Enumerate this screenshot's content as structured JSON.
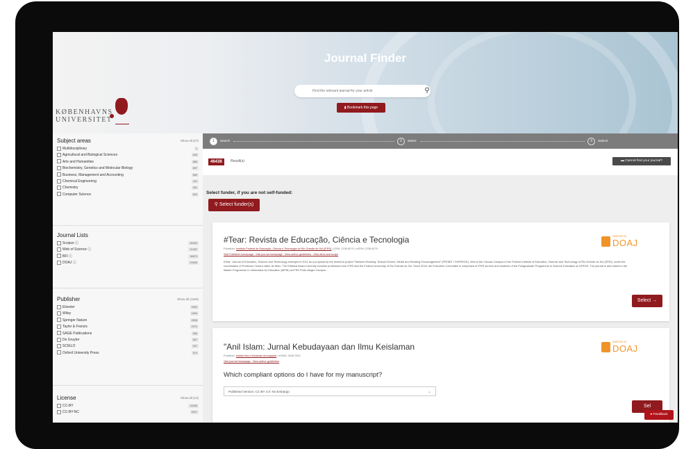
{
  "hero": {
    "title": "Journal Finder",
    "search_placeholder": "Find the relevant journal for your article",
    "bookmark_label": "Bookmark this page",
    "logo_line1": "KØBENHAVNS",
    "logo_line2": "UNIVERSITET"
  },
  "sidebar": {
    "subject_areas": {
      "title": "Subject areas",
      "show_all": "Show all (27)",
      "items": [
        {
          "label": "Multidisciplinary",
          "count": "1"
        },
        {
          "label": "Agricultural and Biological Sciences",
          "count": "840"
        },
        {
          "label": "Arts and Humanities",
          "count": "886"
        },
        {
          "label": "Biochemistry, Genetics and Molecular Biology",
          "count": "697"
        },
        {
          "label": "Business, Management and Accounting",
          "count": "589"
        },
        {
          "label": "Chemical Engineering",
          "count": "411"
        },
        {
          "label": "Chemistry",
          "count": "451"
        },
        {
          "label": "Computer Science",
          "count": "603"
        }
      ]
    },
    "journal_lists": {
      "title": "Journal Lists",
      "items": [
        {
          "label": "Scopus ⓘ",
          "count": "26303"
        },
        {
          "label": "Web of Science ⓘ",
          "count": "21367"
        },
        {
          "label": "BFI ⓘ",
          "count": "34673"
        },
        {
          "label": "DOAJ ⓘ",
          "count": "19463"
        }
      ]
    },
    "publisher": {
      "title": "Publisher",
      "show_all": "Show all (1193)",
      "items": [
        {
          "label": "Elsevier",
          "count": "2693"
        },
        {
          "label": "Wiley",
          "count": "1826"
        },
        {
          "label": "Springer Nature",
          "count": "2638"
        },
        {
          "label": "Taylor & Francis",
          "count": "2372"
        },
        {
          "label": "SAGE Publications",
          "count": "965"
        },
        {
          "label": "De Gruyter",
          "count": "897"
        },
        {
          "label": "SCIELO",
          "count": "547"
        },
        {
          "label": "Oxford University Press",
          "count": "519"
        }
      ]
    },
    "license": {
      "title": "License",
      "show_all": "Show all (13)",
      "items": [
        {
          "label": "CC-BY",
          "count": "10496"
        },
        {
          "label": "CC-BY-NC",
          "count": "3327"
        }
      ]
    }
  },
  "steps": {
    "s1": {
      "num": "1",
      "label": "Search"
    },
    "s2": {
      "num": "2",
      "label": "Select"
    },
    "s3": {
      "num": "3",
      "label": "Submit"
    }
  },
  "results": {
    "count": "46438",
    "label": "Result(s)",
    "cannot_find": "Cannot find your journal?"
  },
  "funder": {
    "label": "Select funder, if you are not self-funded:",
    "button": "Select funder(s)"
  },
  "card1": {
    "title": "#Tear: Revista de Educação, Ciência e Tecnologia",
    "publisher_prefix": "Publisher: ",
    "publisher": "Instituto Federal de Educação, Ciência e Tecnologia do Rio Grande do Sul (IFRS)",
    "issn": " | ISSN: 2238-8079 | eISSN: 2238-8079",
    "link1": "Visit Publisher homepage",
    "link2": "Visit journal homepage",
    "link3": "View author guidelines",
    "link4": "View aims and scope",
    "description": "#Tear: Journal of Education, Science and Technology emerged in 2011 as a proposal by the research project \"Network Reading: Textual Genres, Media and Reading Encouragement\" (PROBIT / FAPERGS), held at the Canoas Campus of the Federal Institute of Education, Science and Technology of Rio Grande do Sul (IFRS), under the coordination of Professor Cimara Valim de Melo. The Editorial Board currently includes professors from IFRS and the Federal University of Rio Grande do Sul. Since 2018, the Executive Committee is comprised of IFRS servers and students of the Postgraduate Programme in Science Education at UFRGS. The journal is also linked to the Master Programme in Informatics for Education (MPIE) at IFRS Porto Alegre Campus.",
    "doaj_small": "INDEXED IN",
    "doaj_big": "DOAJ",
    "select": "Select →"
  },
  "card2": {
    "title": "\"Anil Islam: Jurnal Kebudayaan dan Ilmu Keislaman",
    "publisher_prefix": "Publisher: ",
    "publisher": "Institut Ilmu Keislaman Annuqayah",
    "issn": " | eISSN: 2528-7532",
    "link1": "Visit journal homepage",
    "link2": "View author guidelines",
    "question": "Which compliant options do I have for my manuscript?",
    "dropdown": "Published Version: CC-BY 4.0: No Embargo",
    "doaj_small": "INDEXED IN",
    "doaj_big": "DOAJ",
    "select": "Sel",
    "feedback": "Feedback"
  }
}
